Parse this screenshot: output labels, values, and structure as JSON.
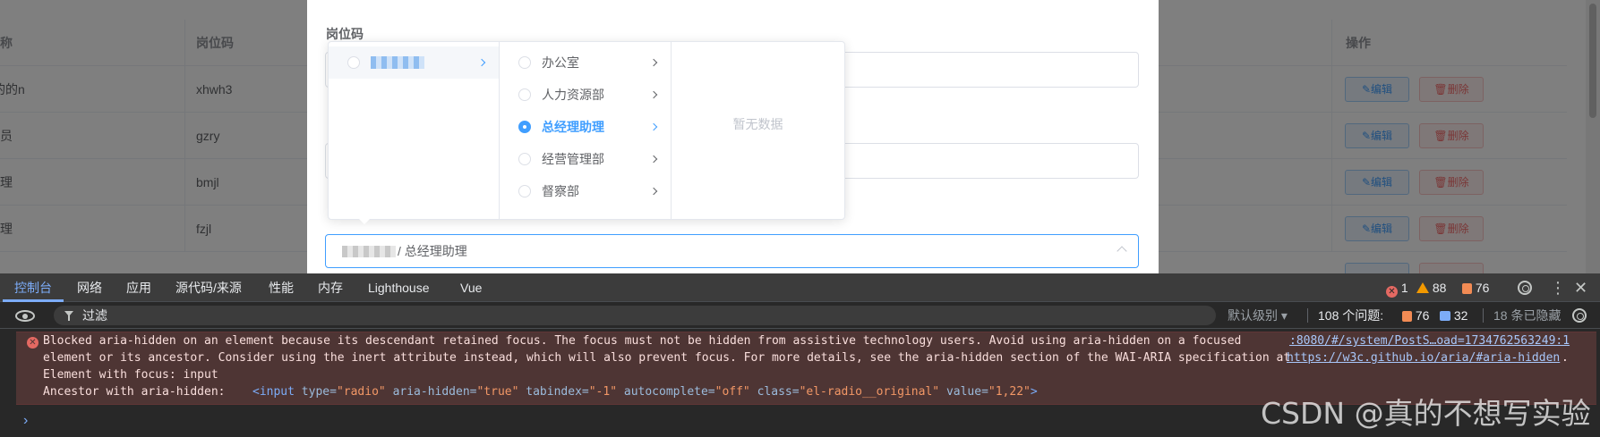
{
  "table": {
    "headers": [
      "名称",
      "岗位码",
      "操作"
    ],
    "rows": [
      {
        "name": "的的n",
        "code": "xhwh3"
      },
      {
        "name": "员",
        "code": "gzry"
      },
      {
        "name": "理",
        "code": "bmjl"
      },
      {
        "name": "理",
        "code": "fzjl"
      }
    ],
    "edit_label": "✎编辑",
    "delete_label": "🗑删除"
  },
  "dialog": {
    "field_label": "岗位码",
    "cascader_value": "/ 总经理助理",
    "cascader_menu_2": [
      {
        "label": "办公室",
        "checked": false
      },
      {
        "label": "人力资源部",
        "checked": false
      },
      {
        "label": "总经理助理",
        "checked": true
      },
      {
        "label": "经营管理部",
        "checked": false
      },
      {
        "label": "督察部",
        "checked": false
      }
    ],
    "empty_text": "暂无数据"
  },
  "devtools": {
    "tabs": [
      "控制台",
      "网络",
      "应用",
      "源代码/来源",
      "性能",
      "内存",
      "Lighthouse",
      "Vue"
    ],
    "active_tab": "控制台",
    "counts": {
      "errors": "1",
      "warnings": "88",
      "issues": "76"
    },
    "filter_placeholder": "过滤",
    "level_label": "默认级别 ▾",
    "issues_label": "108 个问题:",
    "issues_orange": "76",
    "issues_blue": "32",
    "hidden_label": "18 条已隐藏",
    "error": {
      "line1": "Blocked aria-hidden on an element because its descendant retained focus. The focus must not be hidden from assistive technology users. Avoid using aria-hidden on a focused",
      "line2": "element or its ancestor. Consider using the inert attribute instead, which will also prevent focus. For more details, see the aria-hidden section of the WAI-ARIA specification at",
      "link": "https://w3c.github.io/aria/#aria-hidden",
      "line3": "Element with focus: input",
      "line4_label": "Ancestor with aria-hidden:",
      "source": ":8080/#/system/PostS…oad=1734762563249:1"
    },
    "colors": {
      "accent": "#7cacf8",
      "error_bg": "#4e3534",
      "panel_bg": "#282828"
    }
  },
  "watermark": "CSDN @真的不想写实验"
}
